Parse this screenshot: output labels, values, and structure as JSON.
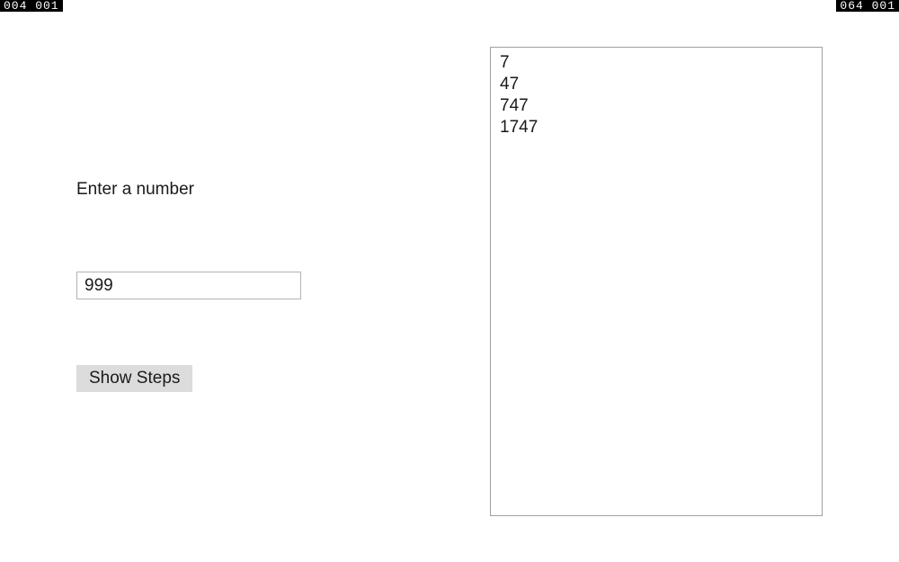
{
  "counters": {
    "left": "004  001",
    "right": "064  001"
  },
  "form": {
    "label": "Enter a number",
    "input_value": "999",
    "button_label": "Show Steps"
  },
  "output": {
    "lines": [
      "7",
      "47",
      "747",
      "1747"
    ]
  }
}
